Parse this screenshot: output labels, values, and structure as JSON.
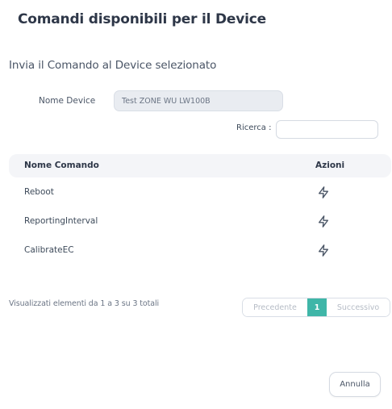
{
  "modal": {
    "title": "Comandi disponibili per il Device",
    "section_title": "Invia il Comando al Device selezionato"
  },
  "device": {
    "label": "Nome Device",
    "value": "Test ZONE WU LW100B"
  },
  "search": {
    "label": "Ricerca :",
    "value": ""
  },
  "table": {
    "headers": {
      "name": "Nome Comando",
      "actions": "Azioni"
    },
    "rows": [
      {
        "name": "Reboot",
        "action_icon": "lightning-icon"
      },
      {
        "name": "ReportingInterval",
        "action_icon": "lightning-icon"
      },
      {
        "name": "CalibrateEC",
        "action_icon": "lightning-icon"
      }
    ]
  },
  "pagination": {
    "info": "Visualizzati elementi da 1 a 3 su 3 totali",
    "previous": "Precedente",
    "current_page": "1",
    "next": "Successivo"
  },
  "footer": {
    "cancel_label": "Annulla"
  },
  "colors": {
    "accent": "#3fb6a8",
    "header_bg": "#f4f5f8",
    "readonly_bg": "#e9ecf1"
  }
}
